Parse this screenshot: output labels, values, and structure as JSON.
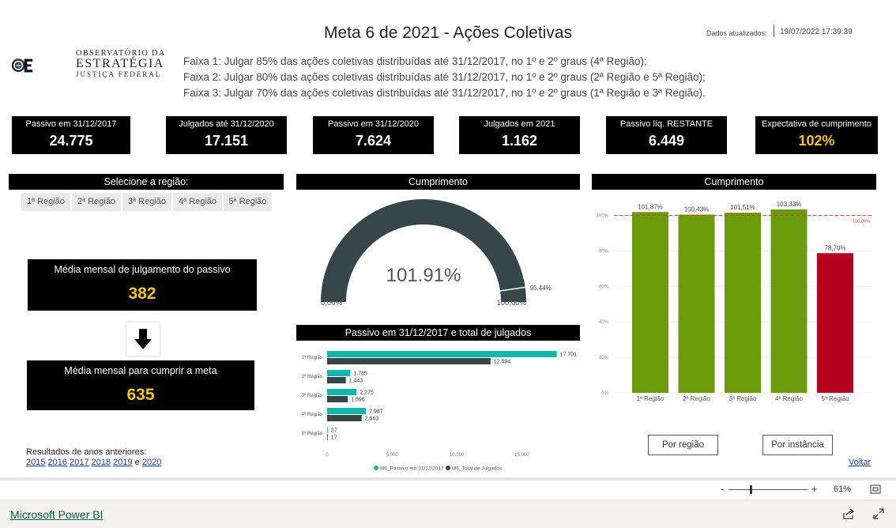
{
  "header": {
    "title": "Meta 6 de 2021 - Ações Coletivas",
    "updated_label": "Dados atualizados:",
    "updated_value": "19/07/2022 17:39:39"
  },
  "logo": {
    "line1": "OBSERVATÓRIO DA",
    "line2": "ESTRATÉGIA",
    "line3": "JUSTIÇA FEDERAL"
  },
  "faixas": [
    "Faixa 1: Julgar 85% das ações coletivas distribuídas até 31/12/2017, no 1º e 2º graus (4ª Região);",
    "Faixa 2: Julgar 80% das ações coletivas distribuídas até 31/12/2017, no 1º e 2º graus (2ª Região e 5ª Região);",
    "Faixa 3: Julgar 70% das ações coletivas distribuídas até 31/12/2017, no 1º e 2º graus (1ª Região e 3ª Região)."
  ],
  "kpis": [
    {
      "label": "Passivo em 31/12/2017",
      "value": "24.775"
    },
    {
      "label": "Julgados até 31/12/2020",
      "value": "17.151"
    },
    {
      "label": "Passivo em 31/12/2020",
      "value": "7.624"
    },
    {
      "label": "Julgados em 2021",
      "value": "1.162"
    },
    {
      "label": "Passivo líq. RESTANTE",
      "value": "6.449"
    },
    {
      "label": "Expectativa de cumprimento",
      "value": "102%"
    }
  ],
  "region_selector": {
    "title": "Selecione a região:",
    "options": [
      "1ª Região",
      "2ª Região",
      "3ª Região",
      "4ª Região",
      "5ª Região"
    ]
  },
  "media_passivo": {
    "label": "Média mensal de julgamento do passivo",
    "value": "382"
  },
  "media_meta": {
    "label": "Média mensal para cumprir a meta",
    "value": "635"
  },
  "previous": {
    "label": "Resultados de anos anteriores:",
    "years": [
      "2015",
      "2016",
      "2017",
      "2018",
      "2019"
    ],
    "conj": "e",
    "last": "2020"
  },
  "buttons": {
    "por_regiao": "Por região",
    "por_instancia": "Por instância",
    "voltar": "Voltar"
  },
  "zoom": {
    "minus": "-",
    "plus": "+",
    "level": "61%"
  },
  "footer": {
    "brand": "Microsoft Power BI"
  },
  "colors": {
    "gold": "#f2c811",
    "green": "#6b9a0b",
    "red": "#b5001f",
    "teal": "#10b8a8",
    "dark": "#374649"
  },
  "chart_data": [
    {
      "type": "gauge",
      "title": "Cumprimento",
      "value": 101.91,
      "value_label": "101.91%",
      "min_label": "0,00%",
      "max_label": "100,00%",
      "target_label": "95,44%",
      "target": 95.44,
      "min": 0,
      "max": 100
    },
    {
      "type": "bar",
      "orientation": "horizontal",
      "title": "Passivo em 31/12/2017 e total de julgados",
      "categories": [
        "1ª Região",
        "2ª Região",
        "3ª Região",
        "4ª Região",
        "5ª Região"
      ],
      "series": [
        {
          "name": "M6_Passivo em 31/12/2017",
          "values": [
            17701,
            1785,
            2275,
            2987,
            27
          ],
          "labels": [
            "17.701",
            "1.785",
            "2.275",
            "2.987",
            "27"
          ]
        },
        {
          "name": "M6_Total de Julgados",
          "values": [
            12594,
            1443,
            1596,
            2663,
            17
          ],
          "labels": [
            "12.594",
            "1.443",
            "1.596",
            "2.663",
            "17"
          ]
        }
      ],
      "xticks": [
        "0",
        "5.000",
        "10.000",
        "15.000"
      ],
      "xtick_values": [
        0,
        5000,
        10000,
        15000
      ],
      "xlim": [
        0,
        19000
      ]
    },
    {
      "type": "bar",
      "title": "Cumprimento",
      "categories": [
        "1ª Região",
        "2ª Região",
        "3ª Região",
        "4ª Região",
        "5ª Região"
      ],
      "values": [
        101.87,
        100.43,
        101.51,
        103.33,
        78.7
      ],
      "labels": [
        "101,87%",
        "100,43%",
        "101,51%",
        "103,33%",
        "78,70%"
      ],
      "bar_status": [
        "ok",
        "ok",
        "ok",
        "ok",
        "below"
      ],
      "yticks": [
        "0%",
        "20%",
        "40%",
        "60%",
        "80%",
        "100%"
      ],
      "ytick_values": [
        0,
        20,
        40,
        60,
        80,
        100
      ],
      "ylim": [
        0,
        110
      ],
      "reference": {
        "value": 100,
        "label": "100,00%"
      }
    }
  ]
}
